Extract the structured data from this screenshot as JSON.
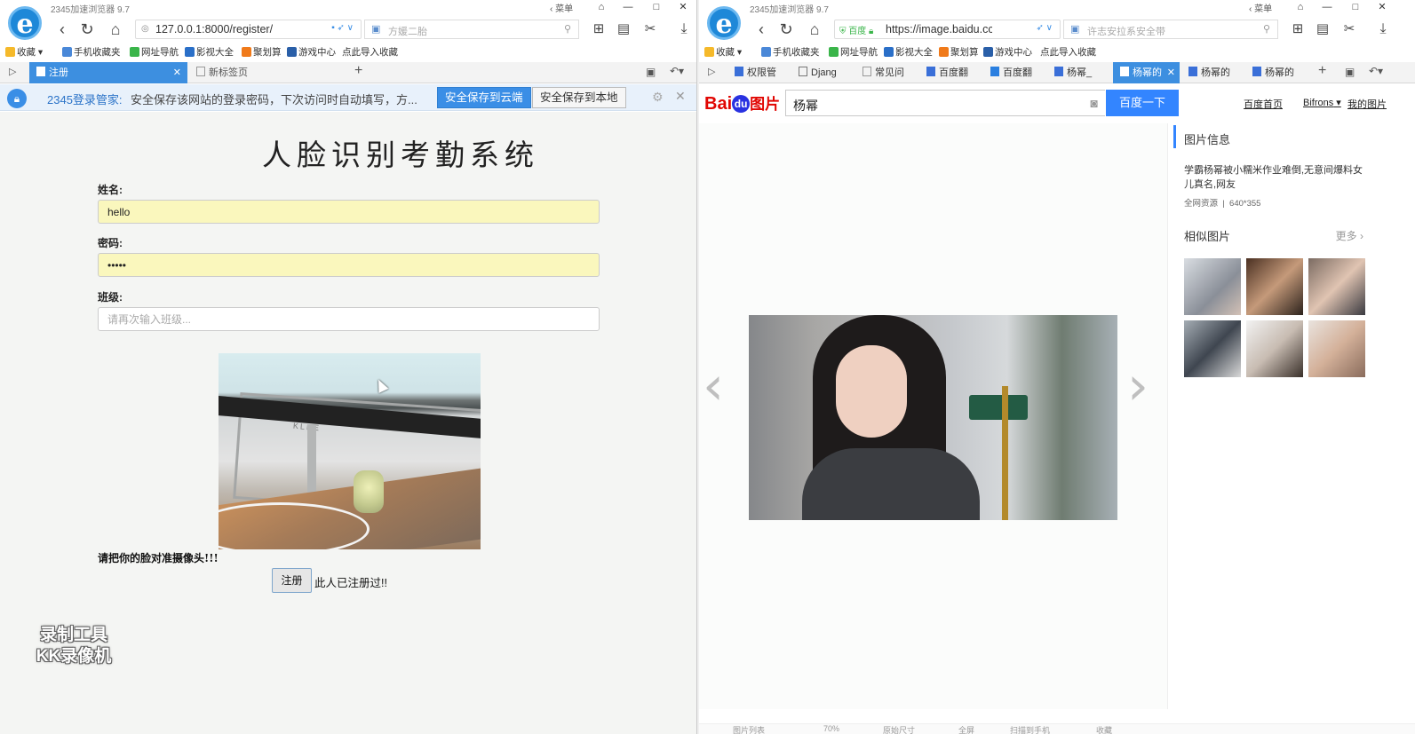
{
  "left": {
    "window_title": "2345加速浏览器 9.7",
    "menu_label": "菜单",
    "address": "127.0.0.1:8000/register/",
    "search_placeholder": "方媛二胎",
    "bookmarks": [
      "收藏",
      "手机收藏夹",
      "网址导航",
      "影视大全",
      "聚划算",
      "游戏中心",
      "点此导入收藏"
    ],
    "tabs": [
      {
        "label": "注册",
        "active": true
      },
      {
        "label": "新标签页",
        "active": false
      }
    ],
    "infobar": {
      "title": "2345登录管家:",
      "message": "安全保存该网站的登录密码，下次访问时自动填写，方...",
      "cloud_button": "安全保存到云端",
      "local_button": "安全保存到本地"
    },
    "page": {
      "title": "人脸识别考勤系统",
      "name_label": "姓名:",
      "name_value": "hello",
      "password_label": "密码:",
      "password_value": "•••••",
      "class_label": "班级:",
      "class_placeholder": "请再次输入班级...",
      "camera_brand": "KLKE",
      "hint": "请把你的脸对准摄像头!!!",
      "register_button": "注册",
      "register_message": "此人已注册过!!"
    },
    "watermark": [
      "录制工具",
      "KK录像机"
    ]
  },
  "right": {
    "window_title": "2345加速浏览器 9.7",
    "menu_label": "菜单",
    "address_site": "百度",
    "address": "https://image.baidu.cc",
    "search_placeholder": "许志安拉系安全带",
    "bookmarks": [
      "收藏",
      "手机收藏夹",
      "网址导航",
      "影视大全",
      "聚划算",
      "游戏中心",
      "点此导入收藏"
    ],
    "tabs": [
      {
        "label": "权限管",
        "active": false
      },
      {
        "label": "Djang",
        "active": false
      },
      {
        "label": "常见问",
        "active": false
      },
      {
        "label": "百度翻",
        "active": false
      },
      {
        "label": "百度翻",
        "active": false
      },
      {
        "label": "杨幂_",
        "active": false
      },
      {
        "label": "杨幂的",
        "active": true
      },
      {
        "label": "杨幂的",
        "active": false
      },
      {
        "label": "杨幂的",
        "active": false
      }
    ],
    "baidu": {
      "logo_bai": "Bai",
      "logo_du": "du",
      "logo_tp": "图片",
      "query": "杨幂",
      "submit": "百度一下",
      "links": [
        "百度首页",
        "Bifrons",
        "我的图片"
      ]
    },
    "info": {
      "heading": "图片信息",
      "description": "学霸杨幂被小糯米作业难倒,无意间爆料女儿真名,网友",
      "source": "全网资源",
      "size": "640*355",
      "similar_heading": "相似图片",
      "more": "更多"
    },
    "status_items": [
      "图片列表",
      "70%",
      "原始尺寸",
      "全屏",
      "扫描到手机",
      "收藏"
    ]
  }
}
